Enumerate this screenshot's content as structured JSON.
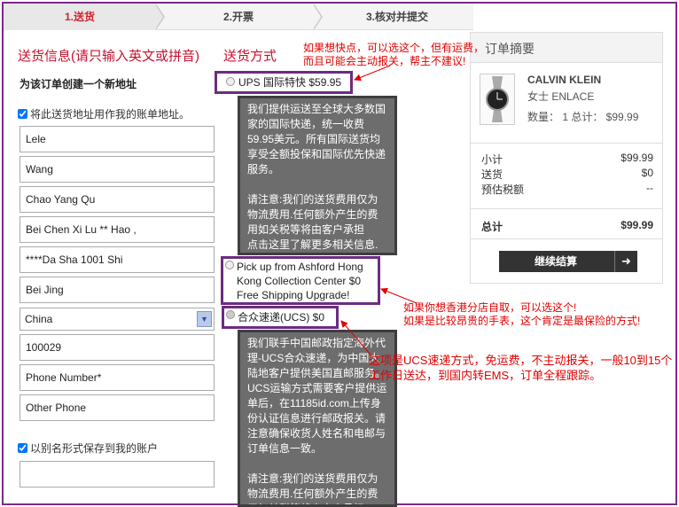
{
  "steps": [
    {
      "label": "1.送货",
      "active": true
    },
    {
      "label": "2.开票",
      "active": false
    },
    {
      "label": "3.核对并提交",
      "active": false
    }
  ],
  "address": {
    "section_title": "送货信息(请只输入英文或拼音)",
    "new_address_label": "为该订单创建一个新地址",
    "use_as_billing_label": "将此送货地址用作我的账单地址。",
    "fields": [
      "Lele",
      "Wang",
      "Chao Yang Qu",
      "Bei Chen Xi Lu ** Hao ,",
      "****Da Sha 1001 Shi",
      "Bei Jing"
    ],
    "country": "China",
    "postal_code": "100029",
    "phone_placeholder": "Phone Number*",
    "other_phone_placeholder": "Other Phone",
    "save_alias_label": "以别名形式保存到我的账户",
    "alias_value": ""
  },
  "shipping": {
    "section_title": "送货方式",
    "ups_label": "UPS 国际特快 $59.95",
    "ups_info": "我们提供运送至全球大多数国家的国际快递，统一收费59.95美元。所有国际送货均享受全额投保和国际优先快递服务。\n\n请注意:我们的送货费用仅为物流费用.任何额外产生的费用如关税等将由客户承担\n点击这里了解更多相关信息.",
    "hk_label": "Pick up from Ashford Hong Kong Collection Center $0 Free Shipping Upgrade!",
    "ucs_label": "合众速递(UCS) $0",
    "ucs_info": "我们联手中国邮政指定海外代理-UCS合众速递，为中国大陆地客户提供美国直邮服务。UCS运输方式需要客户提供运单后，在11185id.com上传身份认证信息进行邮政报关。请注意确保收货人姓名和电邮与订单信息一致。\n\n请注意:我们的送货费用仅为物流费用.任何额外产生的费用如关税等将由客户承担"
  },
  "summary": {
    "title": "订单摘要",
    "brand": "CALVIN KLEIN",
    "product_name": "女士 ENLACE",
    "qty_text": "数量： 1  总计： $99.99",
    "subtotal_label": "小计",
    "subtotal_value": "$99.99",
    "shipping_label": "送货",
    "shipping_value": "$0",
    "tax_label": "预估税额",
    "tax_value": "--",
    "total_label": "总计",
    "total_value": "$99.99",
    "checkout_label": "继续结算",
    "checkout_arrow": "➜"
  },
  "annotations": {
    "note_ups": "如果想快点，可以选这个，但有运费，而且可能会主动报关，帮主不建议!",
    "note_hk": "如果你想香港分店自取，可以选这个!\n如果是比较昂贵的手表，这个肯定是最保险的方式!",
    "note_ucs": "这项是UCS速递方式，免运费，不主动报关，一般10到15个工作日送达，到国内转EMS，订单全程跟踪。"
  },
  "colors": {
    "accent_red": "#c8102e",
    "annotation_red": "#e30000",
    "highlight_purple": "#6b2c82",
    "info_gray": "#6d6d6d"
  }
}
